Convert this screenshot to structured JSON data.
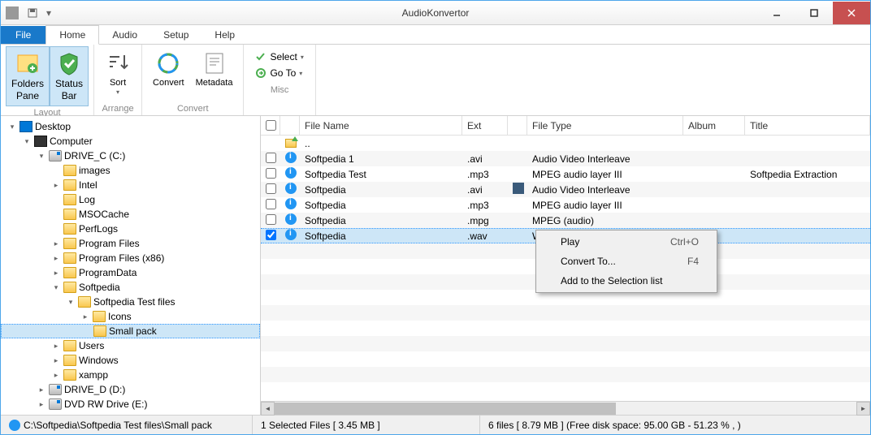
{
  "title": "AudioKonvertor",
  "tabs": {
    "file": "File",
    "home": "Home",
    "audio": "Audio",
    "setup": "Setup",
    "help": "Help"
  },
  "ribbon": {
    "layout": {
      "label": "Layout",
      "folders_pane": "Folders\nPane",
      "status_bar": "Status\nBar"
    },
    "arrange": {
      "label": "Arrange",
      "sort": "Sort"
    },
    "convert": {
      "label": "Convert",
      "convert": "Convert",
      "metadata": "Metadata"
    },
    "misc": {
      "label": "Misc",
      "select": "Select",
      "goto": "Go To"
    }
  },
  "tree": [
    {
      "depth": 0,
      "toggle": "▾",
      "icon": "desk",
      "label": "Desktop"
    },
    {
      "depth": 1,
      "toggle": "▾",
      "icon": "comp",
      "label": "Computer"
    },
    {
      "depth": 2,
      "toggle": "▾",
      "icon": "drive",
      "label": "DRIVE_C (C:)"
    },
    {
      "depth": 3,
      "toggle": "",
      "icon": "folder",
      "label": "images"
    },
    {
      "depth": 3,
      "toggle": "▸",
      "icon": "folder",
      "label": "Intel"
    },
    {
      "depth": 3,
      "toggle": "",
      "icon": "folder",
      "label": "Log"
    },
    {
      "depth": 3,
      "toggle": "",
      "icon": "folder",
      "label": "MSOCache"
    },
    {
      "depth": 3,
      "toggle": "",
      "icon": "folder",
      "label": "PerfLogs"
    },
    {
      "depth": 3,
      "toggle": "▸",
      "icon": "folder",
      "label": "Program Files"
    },
    {
      "depth": 3,
      "toggle": "▸",
      "icon": "folder",
      "label": "Program Files (x86)"
    },
    {
      "depth": 3,
      "toggle": "▸",
      "icon": "folder",
      "label": "ProgramData"
    },
    {
      "depth": 3,
      "toggle": "▾",
      "icon": "folder",
      "label": "Softpedia"
    },
    {
      "depth": 4,
      "toggle": "▾",
      "icon": "folder",
      "label": "Softpedia Test files"
    },
    {
      "depth": 5,
      "toggle": "▸",
      "icon": "folder",
      "label": "Icons"
    },
    {
      "depth": 5,
      "toggle": "",
      "icon": "folder",
      "label": "Small pack",
      "selected": true
    },
    {
      "depth": 3,
      "toggle": "▸",
      "icon": "folder",
      "label": "Users"
    },
    {
      "depth": 3,
      "toggle": "▸",
      "icon": "folder",
      "label": "Windows"
    },
    {
      "depth": 3,
      "toggle": "▸",
      "icon": "folder",
      "label": "xampp"
    },
    {
      "depth": 2,
      "toggle": "▸",
      "icon": "drive",
      "label": "DRIVE_D (D:)"
    },
    {
      "depth": 2,
      "toggle": "▸",
      "icon": "drive",
      "label": "DVD RW Drive (E:)"
    }
  ],
  "columns": {
    "name": "File Name",
    "ext": "Ext",
    "type": "File Type",
    "album": "Album",
    "title": "Title"
  },
  "files": [
    {
      "up": true,
      "name": "..",
      "ext": "",
      "type": "",
      "album": "",
      "title": ""
    },
    {
      "checked": false,
      "name": "Softpedia 1",
      "ext": ".avi",
      "type": "Audio Video Interleave",
      "album": "",
      "title": ""
    },
    {
      "checked": false,
      "name": "Softpedia Test",
      "ext": ".mp3",
      "type": "MPEG audio layer III",
      "album": "",
      "title": "Softpedia Extraction"
    },
    {
      "checked": false,
      "name": "Softpedia",
      "ext": ".avi",
      "type": "Audio Video Interleave",
      "album": "",
      "title": "",
      "thumb": true
    },
    {
      "checked": false,
      "name": "Softpedia",
      "ext": ".mp3",
      "type": "MPEG audio layer III",
      "album": "",
      "title": ""
    },
    {
      "checked": false,
      "name": "Softpedia",
      "ext": ".mpg",
      "type": "MPEG (audio)",
      "album": "",
      "title": ""
    },
    {
      "checked": true,
      "selected": true,
      "name": "Softpedia",
      "ext": ".wav",
      "type": "Windows Wave",
      "album": "",
      "title": ""
    }
  ],
  "context_menu": [
    {
      "label": "Play",
      "shortcut": "Ctrl+O"
    },
    {
      "label": "Convert To...",
      "shortcut": "F4"
    },
    {
      "label": "Add to the Selection list",
      "shortcut": ""
    }
  ],
  "status": {
    "path": "C:\\Softpedia\\Softpedia Test files\\Small pack",
    "selected": "1 Selected Files  [ 3.45 MB ]",
    "summary": "6 files [ 8.79 MB ]  (Free disk space:  95.00 GB -  51.23 % , )"
  }
}
